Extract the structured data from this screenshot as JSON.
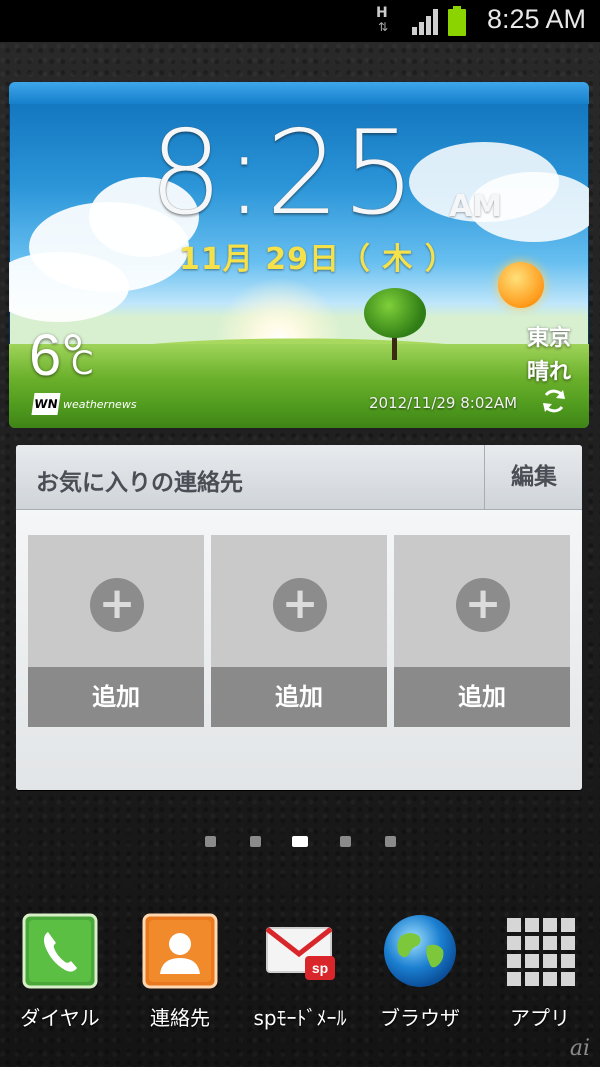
{
  "status_bar": {
    "network": "H",
    "network_arrows": "⇅",
    "time": "8:25 AM",
    "battery_color": "#8bd400"
  },
  "weather_widget": {
    "time": "8:25",
    "ampm": "AM",
    "date": "11月 29日（ 木 ）",
    "temperature": "6°",
    "temperature_unit": "C",
    "provider": "weathernews",
    "provider_logo": "WN",
    "city": "東京",
    "condition": "晴れ",
    "updated": "2012/11/29 8:02AM",
    "refresh_icon": "refresh-icon"
  },
  "favorites_widget": {
    "title": "お気に入りの連絡先",
    "edit_label": "編集",
    "slots": [
      {
        "label": "追加",
        "icon": "+"
      },
      {
        "label": "追加",
        "icon": "+"
      },
      {
        "label": "追加",
        "icon": "+"
      }
    ]
  },
  "page_indicator": {
    "count": 5,
    "active_index": 2
  },
  "dock": [
    {
      "label": "ダイヤル",
      "icon": "phone-icon"
    },
    {
      "label": "連絡先",
      "icon": "contacts-icon"
    },
    {
      "label": "spﾓｰﾄﾞﾒｰﾙ",
      "icon": "mail-icon"
    },
    {
      "label": "ブラウザ",
      "icon": "globe-icon"
    },
    {
      "label": "アプリ",
      "icon": "apps-grid-icon"
    }
  ],
  "watermark": "ai"
}
